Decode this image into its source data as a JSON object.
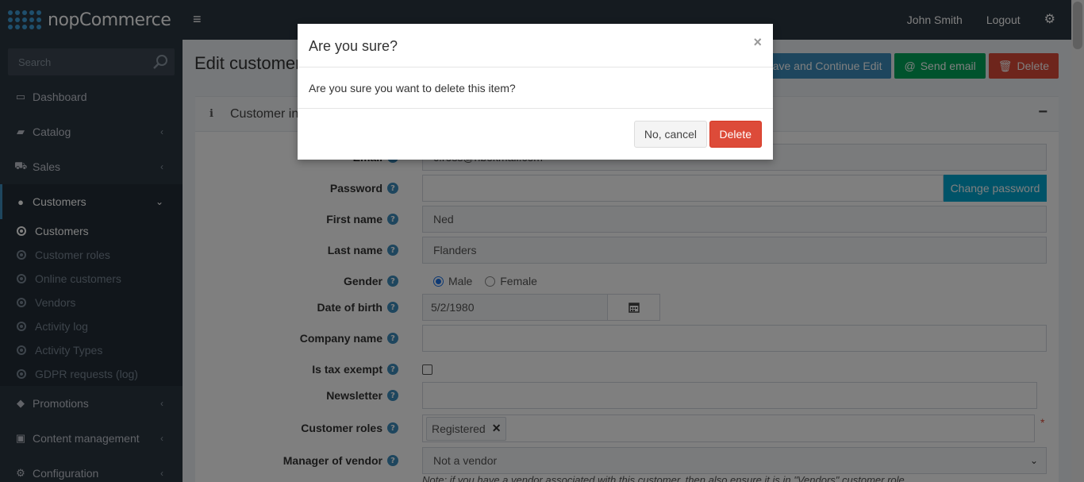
{
  "topbar": {
    "logo_text": "nopCommerce",
    "user_name": "John Smith",
    "logout": "Logout",
    "gear_icon": "gears-icon"
  },
  "sidebar": {
    "search_placeholder": "Search",
    "items": [
      {
        "label": "Dashboard",
        "icon": "desktop-icon"
      },
      {
        "label": "Catalog",
        "icon": "book-icon"
      },
      {
        "label": "Sales",
        "icon": "cart-icon"
      },
      {
        "label": "Customers",
        "icon": "user-icon"
      },
      {
        "label": "Promotions",
        "icon": "tags-icon"
      },
      {
        "label": "Content management",
        "icon": "cubes-icon"
      },
      {
        "label": "Configuration",
        "icon": "gears-icon"
      }
    ],
    "customers_sub": [
      {
        "label": "Customers"
      },
      {
        "label": "Customer roles"
      },
      {
        "label": "Online customers"
      },
      {
        "label": "Vendors"
      },
      {
        "label": "Activity log"
      },
      {
        "label": "Activity Types"
      },
      {
        "label": "GDPR requests (log)"
      }
    ]
  },
  "page": {
    "title": "Edit customer details",
    "actions": {
      "save_continue": "Save and Continue Edit",
      "send_email": "Send email",
      "delete": "Delete"
    },
    "panel_title": "Customer info"
  },
  "form": {
    "email_label": "Email",
    "email_value": "c.ross@nbokmail.com",
    "password_label": "Password",
    "password_value": "",
    "change_password": "Change password",
    "first_name_label": "First name",
    "first_name_value": "Ned",
    "last_name_label": "Last name",
    "last_name_value": "Flanders",
    "gender_label": "Gender",
    "gender_male": "Male",
    "gender_female": "Female",
    "dob_label": "Date of birth",
    "dob_value": "5/2/1980",
    "company_label": "Company name",
    "company_value": "",
    "tax_exempt_label": "Is tax exempt",
    "newsletter_label": "Newsletter",
    "roles_label": "Customer roles",
    "role_tag": "Registered",
    "required_mark": "*",
    "vendor_label": "Manager of vendor",
    "vendor_value": "Not a vendor",
    "vendor_note": "Note: if you have a vendor associated with this customer, then also ensure it is in \"Vendors\" customer role."
  },
  "modal": {
    "title": "Are you sure?",
    "close": "×",
    "message": "Are you sure you want to delete this item?",
    "cancel": "No, cancel",
    "confirm": "Delete"
  }
}
